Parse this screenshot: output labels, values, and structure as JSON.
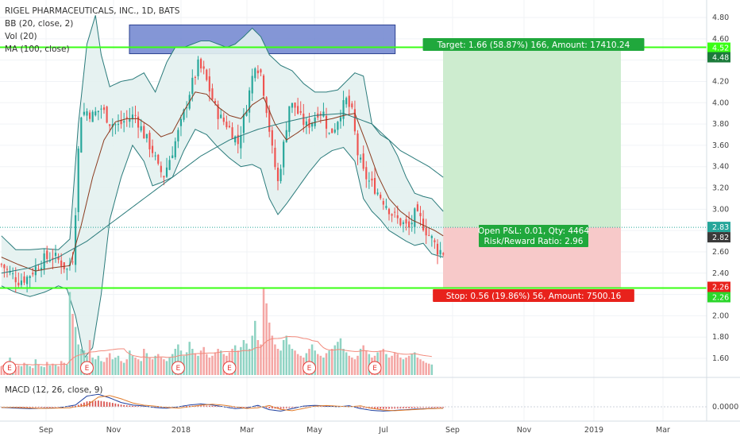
{
  "header": {
    "symbol_line": "RIGEL PHARMACEUTICALS, INC., 1D, BATS",
    "indicators": [
      "BB (20, close, 2)",
      "Vol (20)",
      "MA (100, close)"
    ]
  },
  "macd_label": "MACD (12, 26, close, 9)",
  "colors": {
    "up": "#26a69a",
    "down": "#ef5350",
    "bb": "#2a7b7b",
    "bb_fill": "#e3f1f0",
    "ma20": "#8a3a1e",
    "ma100": "#2a7b7b",
    "level_line": "#39ff14",
    "target_zone": "#cdeccf",
    "stop_zone": "#f7c9c9",
    "supply_box": "#5b6fb8"
  },
  "chart_data": [
    {
      "type": "line",
      "title": "",
      "subtitle": "",
      "yaxis_ticks": [
        "4.80",
        "4.60",
        "4.40",
        "4.20",
        "4.00",
        "3.80",
        "3.60",
        "3.40",
        "3.20",
        "3.00",
        "2.80",
        "2.60",
        "2.40",
        "2.20",
        "2.00",
        "1.80",
        "1.60"
      ],
      "xaxis_ticks": [
        "Sep",
        "Nov",
        "2018",
        "Mar",
        "May",
        "Jul",
        "Sep",
        "Nov",
        "2019",
        "Mar"
      ],
      "ylim": [
        1.5,
        4.9
      ],
      "price_path": [
        [
          0,
          2.48
        ],
        [
          3,
          2.4
        ],
        [
          6,
          2.33
        ],
        [
          9,
          2.36
        ],
        [
          12,
          2.45
        ],
        [
          15,
          2.53
        ],
        [
          18,
          2.56
        ],
        [
          21,
          2.5
        ],
        [
          23,
          2.43
        ],
        [
          25,
          2.55
        ],
        [
          26,
          3.0
        ],
        [
          27,
          3.55
        ],
        [
          28,
          3.9
        ],
        [
          30,
          3.92
        ],
        [
          32,
          3.88
        ],
        [
          35,
          3.95
        ],
        [
          38,
          3.82
        ],
        [
          41,
          3.78
        ],
        [
          44,
          3.85
        ],
        [
          47,
          3.88
        ],
        [
          50,
          3.7
        ],
        [
          53,
          3.55
        ],
        [
          55,
          3.38
        ],
        [
          57,
          3.32
        ],
        [
          60,
          3.55
        ],
        [
          63,
          3.8
        ],
        [
          66,
          4.1
        ],
        [
          69,
          4.35
        ],
        [
          71,
          4.28
        ],
        [
          73,
          4.12
        ],
        [
          75,
          3.95
        ],
        [
          77,
          3.85
        ],
        [
          79,
          3.8
        ],
        [
          81,
          3.72
        ],
        [
          83,
          3.62
        ],
        [
          85,
          3.85
        ],
        [
          87,
          4.1
        ],
        [
          89,
          4.38
        ],
        [
          91,
          4.28
        ],
        [
          93,
          3.95
        ],
        [
          95,
          3.55
        ],
        [
          97,
          3.25
        ],
        [
          99,
          3.6
        ],
        [
          101,
          3.98
        ],
        [
          103,
          3.96
        ],
        [
          105,
          3.85
        ],
        [
          107,
          3.78
        ],
        [
          109,
          3.83
        ],
        [
          111,
          3.92
        ],
        [
          113,
          3.9
        ],
        [
          115,
          3.7
        ],
        [
          117,
          3.78
        ],
        [
          119,
          3.92
        ],
        [
          121,
          4.02
        ],
        [
          123,
          3.9
        ],
        [
          125,
          3.52
        ],
        [
          127,
          3.34
        ],
        [
          129,
          3.26
        ],
        [
          131,
          3.2
        ],
        [
          133,
          3.12
        ],
        [
          135,
          3.05
        ],
        [
          137,
          2.96
        ],
        [
          139,
          2.9
        ],
        [
          141,
          2.86
        ],
        [
          143,
          2.82
        ],
        [
          145,
          2.95
        ],
        [
          147,
          2.9
        ],
        [
          149,
          2.8
        ],
        [
          151,
          2.72
        ],
        [
          153,
          2.62
        ],
        [
          155,
          2.6
        ]
      ],
      "bb_upper_path": [
        [
          0,
          2.75
        ],
        [
          5,
          2.62
        ],
        [
          10,
          2.62
        ],
        [
          15,
          2.63
        ],
        [
          20,
          2.62
        ],
        [
          24,
          2.72
        ],
        [
          27,
          3.8
        ],
        [
          30,
          4.55
        ],
        [
          33,
          4.82
        ],
        [
          35,
          4.45
        ],
        [
          38,
          4.15
        ],
        [
          42,
          4.2
        ],
        [
          46,
          4.22
        ],
        [
          50,
          4.28
        ],
        [
          54,
          4.1
        ],
        [
          58,
          4.38
        ],
        [
          61,
          4.52
        ],
        [
          64,
          4.52
        ],
        [
          67,
          4.55
        ],
        [
          70,
          4.58
        ],
        [
          73,
          4.58
        ],
        [
          76,
          4.55
        ],
        [
          79,
          4.52
        ],
        [
          82,
          4.55
        ],
        [
          85,
          4.62
        ],
        [
          88,
          4.7
        ],
        [
          91,
          4.62
        ],
        [
          94,
          4.45
        ],
        [
          98,
          4.35
        ],
        [
          102,
          4.3
        ],
        [
          106,
          4.18
        ],
        [
          110,
          4.1
        ],
        [
          114,
          4.1
        ],
        [
          118,
          4.12
        ],
        [
          121,
          4.2
        ],
        [
          124,
          4.28
        ],
        [
          127,
          4.25
        ],
        [
          130,
          3.8
        ],
        [
          133,
          3.7
        ],
        [
          136,
          3.65
        ],
        [
          139,
          3.5
        ],
        [
          142,
          3.3
        ],
        [
          145,
          3.15
        ],
        [
          148,
          3.12
        ],
        [
          151,
          3.1
        ],
        [
          155,
          2.98
        ]
      ],
      "bb_lower_path": [
        [
          0,
          2.28
        ],
        [
          5,
          2.22
        ],
        [
          10,
          2.18
        ],
        [
          15,
          2.22
        ],
        [
          20,
          2.28
        ],
        [
          23,
          2.25
        ],
        [
          26,
          2.0
        ],
        [
          29,
          1.6
        ],
        [
          32,
          1.7
        ],
        [
          35,
          2.2
        ],
        [
          38,
          2.9
        ],
        [
          42,
          3.3
        ],
        [
          46,
          3.6
        ],
        [
          50,
          3.45
        ],
        [
          53,
          3.22
        ],
        [
          56,
          3.25
        ],
        [
          60,
          3.3
        ],
        [
          64,
          3.55
        ],
        [
          68,
          3.75
        ],
        [
          72,
          3.7
        ],
        [
          76,
          3.58
        ],
        [
          80,
          3.48
        ],
        [
          84,
          3.4
        ],
        [
          88,
          3.42
        ],
        [
          91,
          3.38
        ],
        [
          94,
          3.1
        ],
        [
          97,
          2.95
        ],
        [
          100,
          3.05
        ],
        [
          104,
          3.2
        ],
        [
          108,
          3.35
        ],
        [
          112,
          3.48
        ],
        [
          116,
          3.55
        ],
        [
          120,
          3.58
        ],
        [
          124,
          3.45
        ],
        [
          127,
          3.1
        ],
        [
          130,
          2.98
        ],
        [
          133,
          2.9
        ],
        [
          136,
          2.8
        ],
        [
          139,
          2.75
        ],
        [
          142,
          2.7
        ],
        [
          145,
          2.66
        ],
        [
          148,
          2.68
        ],
        [
          151,
          2.58
        ],
        [
          155,
          2.55
        ]
      ],
      "ma20_path": [
        [
          0,
          2.55
        ],
        [
          6,
          2.48
        ],
        [
          12,
          2.42
        ],
        [
          18,
          2.45
        ],
        [
          24,
          2.47
        ],
        [
          28,
          2.85
        ],
        [
          32,
          3.3
        ],
        [
          36,
          3.65
        ],
        [
          40,
          3.82
        ],
        [
          44,
          3.85
        ],
        [
          48,
          3.85
        ],
        [
          52,
          3.78
        ],
        [
          56,
          3.68
        ],
        [
          60,
          3.72
        ],
        [
          64,
          3.92
        ],
        [
          68,
          4.1
        ],
        [
          72,
          4.08
        ],
        [
          76,
          3.96
        ],
        [
          80,
          3.88
        ],
        [
          84,
          3.85
        ],
        [
          88,
          3.98
        ],
        [
          92,
          4.05
        ],
        [
          96,
          3.8
        ],
        [
          100,
          3.65
        ],
        [
          104,
          3.72
        ],
        [
          108,
          3.8
        ],
        [
          112,
          3.83
        ],
        [
          116,
          3.85
        ],
        [
          120,
          3.88
        ],
        [
          124,
          3.9
        ],
        [
          128,
          3.62
        ],
        [
          132,
          3.32
        ],
        [
          136,
          3.1
        ],
        [
          140,
          2.98
        ],
        [
          144,
          2.9
        ],
        [
          148,
          2.85
        ],
        [
          152,
          2.8
        ],
        [
          155,
          2.75
        ]
      ],
      "ma100_path": [
        [
          0,
          2.4
        ],
        [
          10,
          2.45
        ],
        [
          20,
          2.55
        ],
        [
          30,
          2.7
        ],
        [
          40,
          2.9
        ],
        [
          50,
          3.1
        ],
        [
          60,
          3.3
        ],
        [
          70,
          3.5
        ],
        [
          80,
          3.65
        ],
        [
          90,
          3.75
        ],
        [
          100,
          3.82
        ],
        [
          110,
          3.88
        ],
        [
          120,
          3.9
        ],
        [
          130,
          3.8
        ],
        [
          140,
          3.55
        ],
        [
          150,
          3.4
        ],
        [
          155,
          3.3
        ]
      ],
      "bar_count": 156,
      "volume_bars": [
        0.1,
        0.12,
        0.08,
        0.2,
        0.15,
        0.09,
        0.11,
        0.1,
        0.14,
        0.12,
        0.1,
        0.08,
        0.18,
        0.12,
        0.1,
        0.09,
        0.15,
        0.11,
        0.13,
        0.12,
        0.1,
        0.16,
        0.14,
        0.12,
        0.95,
        0.7,
        0.55,
        0.35,
        0.3,
        0.28,
        0.22,
        0.4,
        0.2,
        0.18,
        0.22,
        0.16,
        0.15,
        0.2,
        0.25,
        0.18,
        0.2,
        0.22,
        0.16,
        0.14,
        0.18,
        0.28,
        0.22,
        0.2,
        0.18,
        0.16,
        0.3,
        0.25,
        0.2,
        0.18,
        0.22,
        0.24,
        0.2,
        0.18,
        0.16,
        0.2,
        0.24,
        0.3,
        0.35,
        0.28,
        0.22,
        0.26,
        0.38,
        0.3,
        0.25,
        0.22,
        0.28,
        0.32,
        0.24,
        0.2,
        0.22,
        0.26,
        0.3,
        0.28,
        0.24,
        0.22,
        0.26,
        0.3,
        0.34,
        0.28,
        0.32,
        0.4,
        0.36,
        0.3,
        0.45,
        0.62,
        0.4,
        0.35,
        1.0,
        0.82,
        0.6,
        0.45,
        0.35,
        0.3,
        0.28,
        0.4,
        0.45,
        0.35,
        0.3,
        0.28,
        0.24,
        0.22,
        0.2,
        0.25,
        0.3,
        0.35,
        0.28,
        0.24,
        0.22,
        0.2,
        0.25,
        0.28,
        0.3,
        0.34,
        0.38,
        0.42,
        0.3,
        0.26,
        0.22,
        0.2,
        0.18,
        0.22,
        0.3,
        0.34,
        0.28,
        0.24,
        0.2,
        0.22,
        0.26,
        0.28,
        0.3,
        0.24,
        0.2,
        0.22,
        0.26,
        0.24,
        0.2,
        0.18,
        0.2,
        0.22,
        0.24,
        0.26,
        0.2,
        0.18,
        0.16,
        0.14,
        0.13,
        0.12
      ],
      "macd_path": [
        [
          0,
          -0.02
        ],
        [
          10,
          -0.05
        ],
        [
          20,
          -0.03
        ],
        [
          26,
          0.05
        ],
        [
          30,
          0.3
        ],
        [
          34,
          0.35
        ],
        [
          38,
          0.25
        ],
        [
          42,
          0.12
        ],
        [
          46,
          0.05
        ],
        [
          50,
          0.02
        ],
        [
          54,
          -0.02
        ],
        [
          58,
          -0.04
        ],
        [
          62,
          0.0
        ],
        [
          66,
          0.05
        ],
        [
          70,
          0.08
        ],
        [
          74,
          0.05
        ],
        [
          78,
          0.0
        ],
        [
          82,
          -0.05
        ],
        [
          86,
          -0.03
        ],
        [
          90,
          0.04
        ],
        [
          94,
          -0.08
        ],
        [
          98,
          -0.12
        ],
        [
          102,
          -0.05
        ],
        [
          106,
          0.02
        ],
        [
          110,
          0.04
        ],
        [
          114,
          0.02
        ],
        [
          118,
          0.0
        ],
        [
          122,
          0.03
        ],
        [
          126,
          -0.05
        ],
        [
          130,
          -0.1
        ],
        [
          134,
          -0.12
        ],
        [
          138,
          -0.1
        ],
        [
          142,
          -0.08
        ],
        [
          146,
          -0.06
        ],
        [
          150,
          -0.05
        ],
        [
          155,
          -0.04
        ]
      ],
      "macd_yaxis_tick": "0.0000",
      "position": {
        "entry": 2.83,
        "target": 4.52,
        "stop": 2.26,
        "target_label": "Target: 1.66 (58.87%) 166, Amount: 17410.24",
        "stop_label": "Stop: 0.56 (19.86%) 56, Amount: 7500.16",
        "pnl_label": "Open P&L: 0.01, Qty: 4464",
        "rr_label": "Risk/Reward Ratio: 2.96"
      },
      "price_tags": [
        {
          "value": "4.52",
          "color": "#39ff14",
          "text_color": "#0a3a0a"
        },
        {
          "value": "4.48",
          "color": "#1b7a3a",
          "text_color": "#ffffff"
        },
        {
          "value": "2.83",
          "color": "#26a69a",
          "text_color": "#ffffff"
        },
        {
          "value": "2.82",
          "color": "#3a3a3a",
          "text_color": "#ffffff"
        },
        {
          "value": "2.26",
          "color": "#e8221c",
          "text_color": "#ffffff"
        },
        {
          "value": "2.26",
          "color": "#2bd62b",
          "text_color": "#0a3a0a"
        }
      ],
      "horizontal_levels": [
        4.52,
        2.26
      ],
      "supply_box": {
        "top": 4.73,
        "bottom": 4.46,
        "start_index": 60,
        "end_index": 127
      },
      "earnings_markers": [
        0,
        30,
        62,
        80,
        108,
        131
      ],
      "earnings_label": "E",
      "legend": []
    }
  ]
}
